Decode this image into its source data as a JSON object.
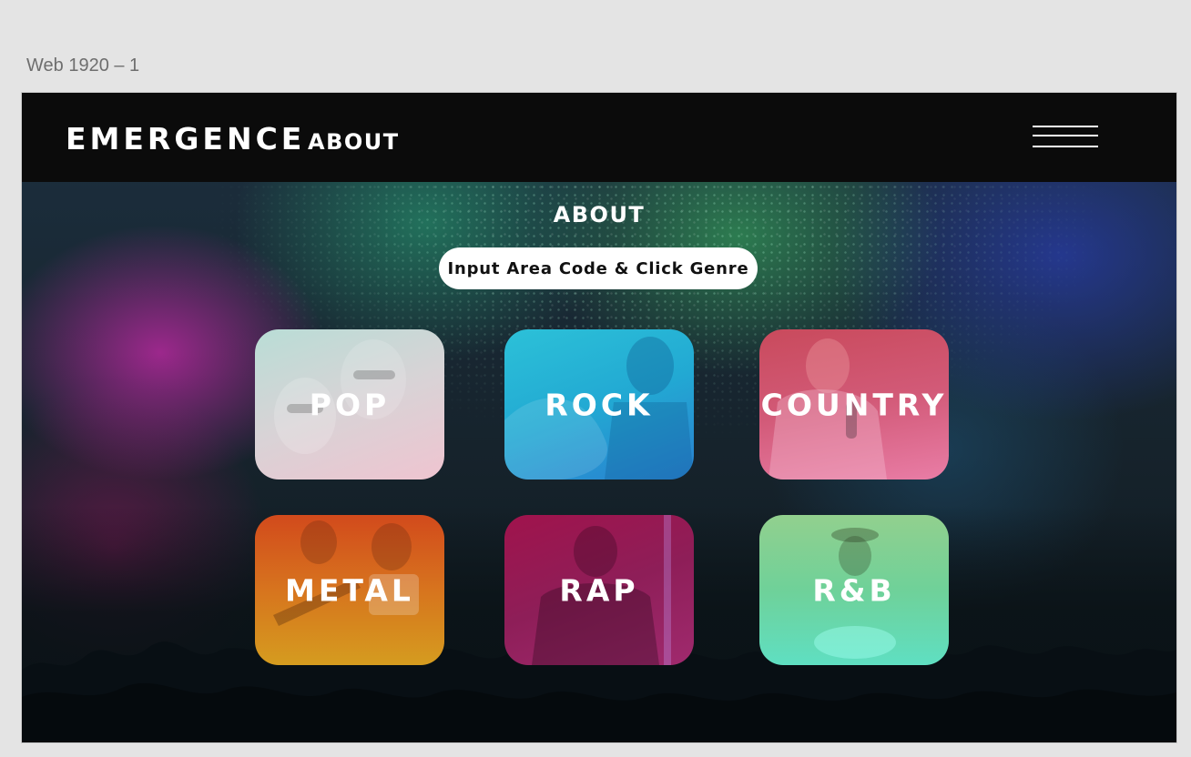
{
  "artboard": {
    "label": "Web 1920 – 1"
  },
  "navbar": {
    "brand": "EMERGENCE",
    "about_link": "ABOUT",
    "menu_icon": "hamburger-menu-icon"
  },
  "main": {
    "title": "ABOUT",
    "search": {
      "placeholder": "Input Area Code & Click Genre",
      "value": ""
    },
    "genres": [
      {
        "label": "POP",
        "color": "#d8d3d6"
      },
      {
        "label": "ROCK",
        "color": "#22a9d3"
      },
      {
        "label": "COUNTRY",
        "color": "#d25a78"
      },
      {
        "label": "METAL",
        "color": "#d7741e"
      },
      {
        "label": "RAP",
        "color": "#8e1e58"
      },
      {
        "label": "R&B",
        "color": "#6fd199"
      }
    ]
  }
}
